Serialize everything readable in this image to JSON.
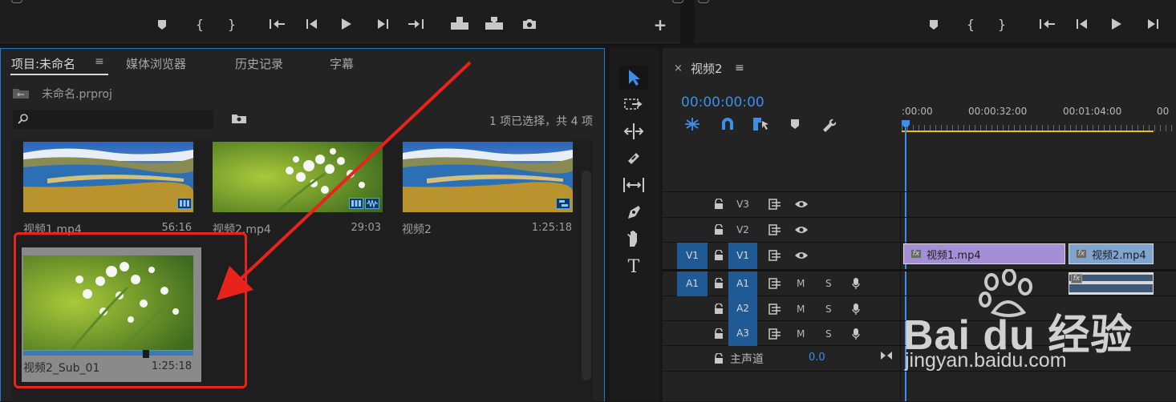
{
  "project_panel": {
    "tabs": [
      {
        "label": "项目:未命名",
        "active": true
      },
      {
        "label": "媒体浏览器",
        "active": false
      },
      {
        "label": "历史记录",
        "active": false
      },
      {
        "label": "字幕",
        "active": false
      }
    ],
    "menu_icon": "≡",
    "project_file": "未命名.prproj",
    "search_placeholder": "",
    "selection_status": "1 项已选择，共 4 项",
    "items": [
      {
        "name": "视频1.mp4",
        "duration": "56:16",
        "badge": "video"
      },
      {
        "name": "视频2.mp4",
        "duration": "29:03",
        "badge": "video-audio"
      },
      {
        "name": "视频2",
        "duration": "1:25:18",
        "badge": "sequence"
      },
      {
        "name": "视频2_Sub_01",
        "duration": "1:25:18",
        "selected": true
      }
    ]
  },
  "timeline": {
    "close_label": "×",
    "sequence_name": "视频2",
    "menu_icon": "≡",
    "timecode": "00:00:00:00",
    "ruler_ticks": [
      ":00:00",
      "00:00:32:00",
      "00:01:04:00",
      "00"
    ],
    "video_tracks": [
      {
        "name": "V3",
        "source": ""
      },
      {
        "name": "V2",
        "source": ""
      },
      {
        "name": "V1",
        "source": "V1"
      }
    ],
    "audio_tracks": [
      {
        "name": "A1",
        "source": "A1",
        "m": "M",
        "s": "S"
      },
      {
        "name": "A2",
        "source": "",
        "m": "M",
        "s": "S"
      },
      {
        "name": "A3",
        "source": "",
        "m": "M",
        "s": "S"
      }
    ],
    "master": {
      "label": "主声道",
      "value": "0.0"
    },
    "clips": [
      {
        "name": "视频1.mp4",
        "fx": "fx",
        "color": "#a48fd6"
      },
      {
        "name": "视频2.mp4",
        "fx": "fx",
        "color": "#7fa4d0"
      }
    ],
    "audio_clip_fx": "fx",
    "playhead_color": "#3d8ee8"
  },
  "watermark": {
    "text": "Bai du 经验",
    "url": "jingyan.baidu.com"
  },
  "colors": {
    "accent": "#2d8ceb",
    "annotation": "#e8231c"
  }
}
